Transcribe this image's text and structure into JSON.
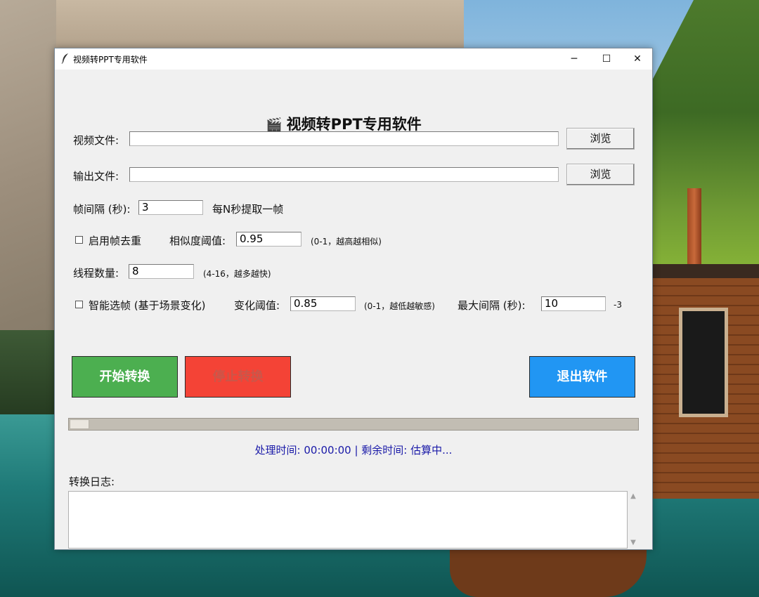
{
  "window": {
    "title": "视频转PPT专用软件",
    "minimize_glyph": "─",
    "maximize_glyph": "☐",
    "close_glyph": "✕"
  },
  "app": {
    "icon": "clapperboard-icon",
    "icon_glyph": "🎬",
    "heading": "视频转PPT专用软件"
  },
  "video_file": {
    "label": "视频文件:",
    "value": "",
    "browse_label": "浏览"
  },
  "output_file": {
    "label": "输出文件:",
    "value": "",
    "browse_label": "浏览"
  },
  "frame_interval": {
    "label": "帧间隔 (秒):",
    "value": "3",
    "hint": "每N秒提取一帧"
  },
  "dedup": {
    "checkbox_label": "启用帧去重",
    "checked": false,
    "threshold_label": "相似度阈值:",
    "threshold_value": "0.95",
    "threshold_hint": "(0-1，越高越相似)"
  },
  "threads": {
    "label": "线程数量:",
    "value": "8",
    "hint": "(4-16，越多越快)"
  },
  "smart": {
    "checkbox_label": "智能选帧 (基于场景变化)",
    "checked": false,
    "change_label": "变化阈值:",
    "change_value": "0.85",
    "change_hint": "(0-1，越低越敏感)",
    "max_interval_label": "最大间隔 (秒):",
    "max_interval_value": "10",
    "max_interval_suffix": "-3"
  },
  "actions": {
    "start_label": "开始转换",
    "stop_label": "停止转换",
    "quit_label": "退出软件",
    "start_color": "#4caf50",
    "stop_color": "#f44336",
    "quit_color": "#2196f3"
  },
  "progress": {
    "value": 0
  },
  "status": {
    "text": "处理时间: 00:00:00 | 剩余时间: 估算中..."
  },
  "log": {
    "label": "转换日志:",
    "content": ""
  }
}
